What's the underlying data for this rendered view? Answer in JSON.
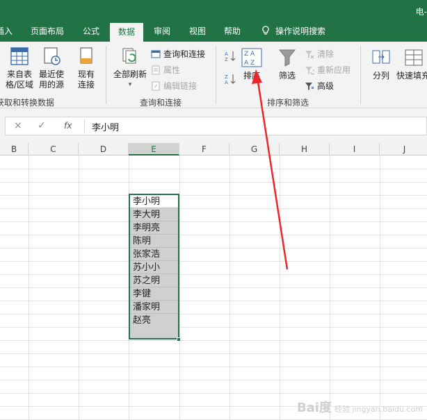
{
  "title_right": "电-",
  "tabs": [
    {
      "label": "插入"
    },
    {
      "label": "页面布局"
    },
    {
      "label": "公式"
    },
    {
      "label": "数据"
    },
    {
      "label": "审阅"
    },
    {
      "label": "视图"
    },
    {
      "label": "帮助"
    }
  ],
  "tell_me": "操作说明搜索",
  "ribbon": {
    "from_table_l1": "来自表",
    "from_table_l2": "格/区域",
    "recent_l1": "最近使",
    "recent_l2": "用的源",
    "existing_l1": "现有",
    "existing_l2": "连接",
    "get_transform_group": "获取和转换数据",
    "refresh_all": "全部刷新",
    "queries_connections": "查询和连接",
    "properties": "属性",
    "edit_links": "编辑链接",
    "queries_group": "查询和连接",
    "sort": "排序",
    "filter": "筛选",
    "clear": "清除",
    "reapply": "重新应用",
    "advanced": "高级",
    "sort_filter_group": "排序和筛选",
    "text_to_columns": "分列",
    "flash_fill": "快速填充"
  },
  "formula_bar": {
    "cancel": "×",
    "enter": "✓",
    "fx": "fx",
    "content": "李小明"
  },
  "columns": [
    "B",
    "C",
    "D",
    "E",
    "F",
    "G",
    "H",
    "I",
    "J"
  ],
  "selected_column": "E",
  "cells": [
    "李小明",
    "李大明",
    "李明亮",
    "陈明",
    "张家浩",
    "苏小小",
    "苏之明",
    "李键",
    "潘家明",
    "赵亮"
  ],
  "watermark": {
    "main": "Bai度",
    "sub": "经验 jingyan.baidu.com"
  },
  "colors": {
    "accent": "#217346",
    "arrow": "#e8262c",
    "selection_fill": "#d0d0d0"
  },
  "icons": [
    "lightbulb-icon",
    "table-icon",
    "recent-sources-icon",
    "existing-connections-icon",
    "refresh-all-icon",
    "queries-connections-icon",
    "properties-icon",
    "edit-links-icon",
    "sort-az-icon",
    "sort-za-icon",
    "sort-icon",
    "filter-icon",
    "clear-icon",
    "reapply-icon",
    "advanced-icon",
    "text-to-columns-icon",
    "flash-fill-icon"
  ]
}
